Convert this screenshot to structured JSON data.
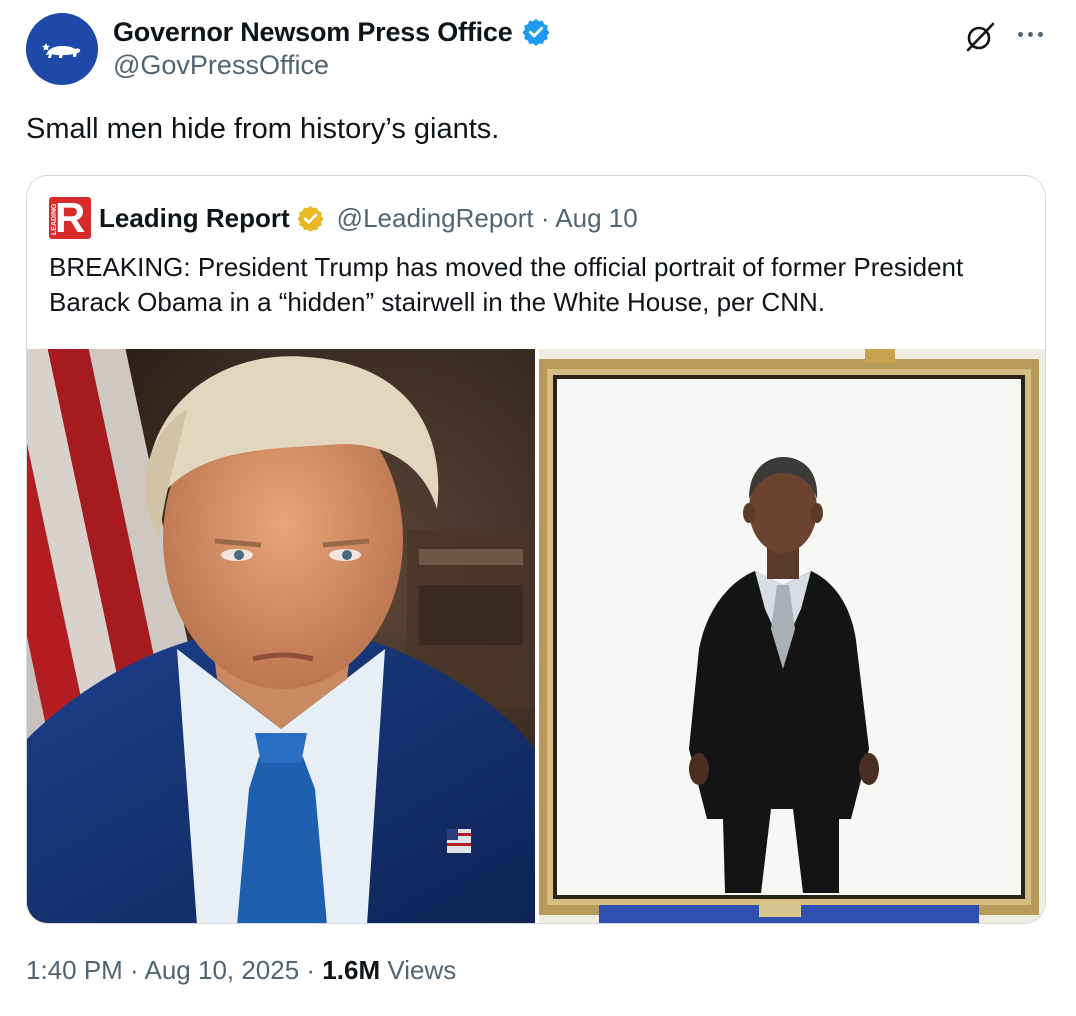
{
  "author": {
    "display_name": "Governor Newsom Press Office",
    "handle": "@GovPressOffice",
    "verified_color": "#1d9bf0",
    "avatar_bg": "#1d4aa8"
  },
  "tweet": {
    "text": "Small men hide from history’s giants."
  },
  "quote": {
    "logo_letter": "R",
    "logo_text": "LEADING",
    "display_name": "Leading Report",
    "handle_date": "@LeadingReport · Aug 10",
    "badge_color": "#e8b923",
    "text": "BREAKING: President Trump has moved the official portrait of former President Barack Obama in a “hidden” stairwell in the White House, per CNN.",
    "media": [
      {
        "alt": "Portrait of Donald Trump"
      },
      {
        "alt": "Official portrait of Barack Obama on an easel"
      }
    ]
  },
  "footer": {
    "time_date": "1:40 PM · Aug 10, 2025 · ",
    "views_count": "1.6M",
    "views_label": " Views"
  },
  "icons": {
    "grok": "grok-icon",
    "more": "more-icon"
  }
}
